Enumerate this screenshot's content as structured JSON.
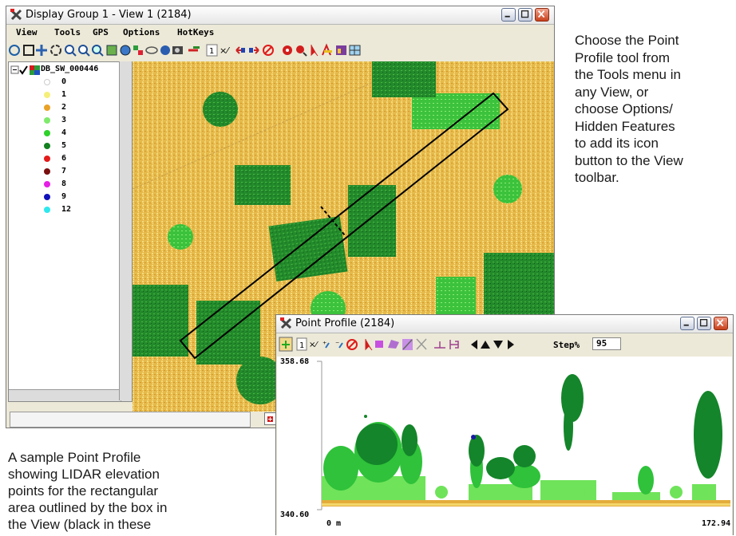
{
  "view_window": {
    "title": "Display Group 1 - View 1 (2184)",
    "menu": [
      "View",
      "Tools",
      "GPS",
      "Options",
      "HotKeys"
    ],
    "toolbar_icons": [
      "rotate-icon",
      "zoom-box-icon",
      "pan-icon",
      "redraw-icon",
      "zoom-in-icon",
      "zoom-out-icon",
      "zoom-layer-icon",
      "full-view-icon",
      "globe-icon",
      "group-icon",
      "orbit-icon",
      "sphere-icon",
      "camera-icon",
      "add-layer-icon",
      "one-to-one-icon",
      "select-icon",
      "back-icon",
      "forward-icon",
      "cancel-icon",
      "gps-icon",
      "find-icon",
      "pointer-icon",
      "profile-icon",
      "chart-icon",
      "grid-icon"
    ],
    "layer_name": "DB_SW_000446",
    "legend": [
      {
        "label": "0",
        "color": "#ffffff"
      },
      {
        "label": "1",
        "color": "#f5ef7a"
      },
      {
        "label": "2",
        "color": "#e9a227"
      },
      {
        "label": "3",
        "color": "#7fea6c"
      },
      {
        "label": "4",
        "color": "#2ed12a"
      },
      {
        "label": "5",
        "color": "#13811f"
      },
      {
        "label": "6",
        "color": "#e41b1b"
      },
      {
        "label": "7",
        "color": "#7a0f0f"
      },
      {
        "label": "8",
        "color": "#e61ee6"
      },
      {
        "label": "9",
        "color": "#1111bb"
      },
      {
        "label": "12",
        "color": "#2ee8ee"
      }
    ]
  },
  "profile_window": {
    "title": "Point Profile (2184)",
    "step_label": "Step%",
    "step_value": "95",
    "y_max_label": "358.68",
    "y_min_label": "340.60",
    "x_min_label": "0 m",
    "x_max_label": "172.94"
  },
  "captions": {
    "right": [
      "Choose the Point",
      "Profile tool from",
      "the Tools menu in",
      "any View, or",
      "choose Options/",
      "Hidden Features",
      "to add its icon",
      "button to the View",
      "toolbar."
    ],
    "bottom": [
      "A sample Point Profile",
      "showing LIDAR elevation",
      "points for the rectangular",
      "area outlined by the box in",
      "the View (black in these"
    ]
  }
}
